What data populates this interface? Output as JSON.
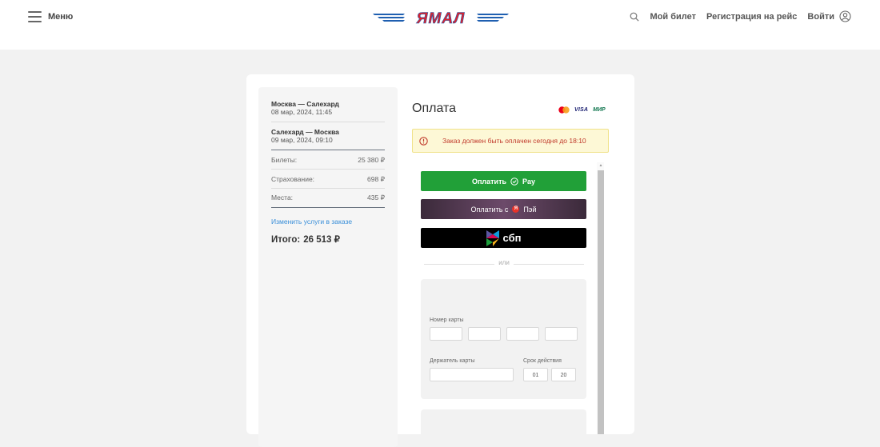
{
  "header": {
    "menu_label": "Меню",
    "logo_text": "ЯМАЛ",
    "nav": {
      "my_ticket": "Мой билет",
      "checkin": "Регистрация на рейс",
      "login": "Войти"
    }
  },
  "summary": {
    "routes": [
      {
        "title": "Москва — Салехард",
        "date": "08 мар, 2024, 11:45"
      },
      {
        "title": "Салехард — Москва",
        "date": "09 мар, 2024, 09:10"
      }
    ],
    "rows": [
      {
        "label": "Билеты:",
        "value": "25 380 ₽"
      },
      {
        "label": "Страхование:",
        "value": "698 ₽"
      },
      {
        "label": "Места:",
        "value": "435 ₽"
      }
    ],
    "change_link": "Изменить услуги в заказе",
    "total_label": "Итого:",
    "total_value": "26 513 ₽"
  },
  "payment": {
    "title": "Оплата",
    "brands": {
      "visa": "VISA",
      "mir": "МИР"
    },
    "warning": "Заказ должен быть оплачен сегодня до 18:10",
    "pay_button": "Оплатить",
    "pay_suffix": "Pay",
    "yapay_button": "Оплатить с",
    "yapay_suffix": "Пэй",
    "sbp_label": "сбп",
    "or_text": "или",
    "form": {
      "card_number_label": "Номер карты",
      "holder_label": "Держатель карты",
      "expiry_label": "Срок действия",
      "expiry_month": "01",
      "expiry_year": "20"
    }
  },
  "colors": {
    "accent_green": "#21a038",
    "warning_text": "#c0392b",
    "link": "#3a8fd9",
    "logo_red": "#e0202a",
    "logo_blue": "#1f5fb0"
  }
}
